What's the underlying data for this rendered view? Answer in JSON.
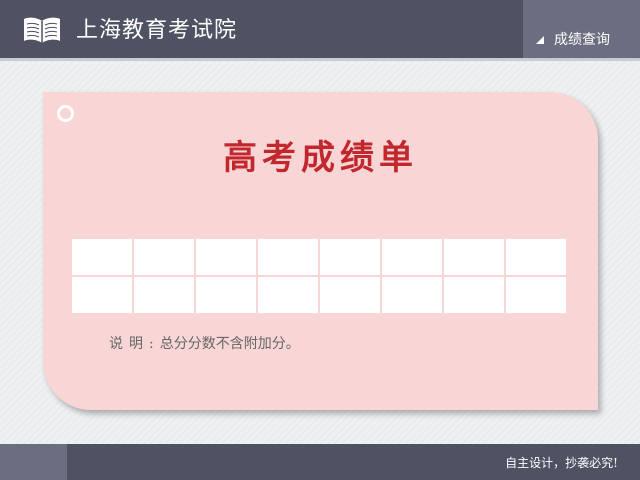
{
  "header": {
    "logo_icon": "open-book-icon",
    "title": "上海教育考试院",
    "nav": {
      "label": "成绩查询",
      "icon": "triangle-bullet-icon"
    },
    "colors": {
      "bar": "#4f5263",
      "accent": "#6b6e80"
    }
  },
  "card": {
    "title": "高考成绩单",
    "title_color": "#c1272d",
    "background": "#f8d6d6",
    "grid": {
      "columns": 8,
      "rows": 2,
      "cells": [
        [
          "",
          "",
          "",
          "",
          "",
          "",
          "",
          ""
        ],
        [
          "",
          "",
          "",
          "",
          "",
          "",
          "",
          ""
        ]
      ]
    },
    "note_label": "说明:",
    "note_text": "总分分数不含附加分。"
  },
  "footer": {
    "text": "自主设计，抄袭必究!"
  }
}
